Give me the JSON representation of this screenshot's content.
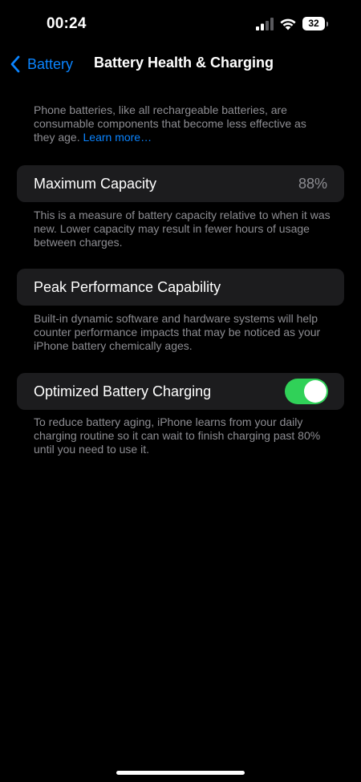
{
  "status_bar": {
    "time": "00:24",
    "battery_level": "32",
    "signal_icon": "cellular-signal-icon",
    "wifi_icon": "wifi-icon",
    "battery_icon": "battery-icon"
  },
  "nav": {
    "back_label": "Battery",
    "back_icon": "chevron-left-icon",
    "title": "Battery Health & Charging"
  },
  "intro": {
    "text": "Phone batteries, like all rechargeable batteries, are consumable components that become less effective as they age.",
    "link": "Learn more…"
  },
  "maximum_capacity": {
    "label": "Maximum Capacity",
    "value": "88%",
    "note": "This is a measure of battery capacity relative to when it was new. Lower capacity may result in fewer hours of usage between charges."
  },
  "peak_performance": {
    "label": "Peak Performance Capability",
    "note": "Built-in dynamic software and hardware systems will help counter performance impacts that may be noticed as your iPhone battery chemically ages."
  },
  "optimized_charging": {
    "label": "Optimized Battery Charging",
    "enabled": true,
    "note": "To reduce battery aging, iPhone learns from your daily charging routine so it can wait to finish charging past 80% until you need to use it."
  },
  "colors": {
    "background": "#000000",
    "cell_background": "#1c1c1e",
    "accent_blue": "#0a84ff",
    "toggle_on": "#30d158",
    "secondary_text": "#8d8d92"
  }
}
